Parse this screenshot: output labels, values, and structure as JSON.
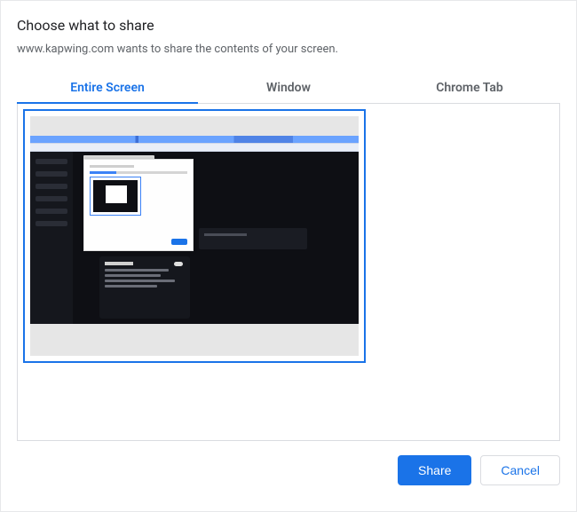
{
  "dialog": {
    "title": "Choose what to share",
    "subtitle": "www.kapwing.com wants to share the contents of your screen."
  },
  "tabs": {
    "entire_screen": "Entire Screen",
    "window": "Window",
    "chrome_tab": "Chrome Tab",
    "active_index": 0
  },
  "previews": {
    "screen1": {
      "selected": true
    }
  },
  "footer": {
    "share": "Share",
    "cancel": "Cancel"
  },
  "colors": {
    "accent": "#1a73e8",
    "border": "#dadce0",
    "text_secondary": "#5f6368"
  }
}
